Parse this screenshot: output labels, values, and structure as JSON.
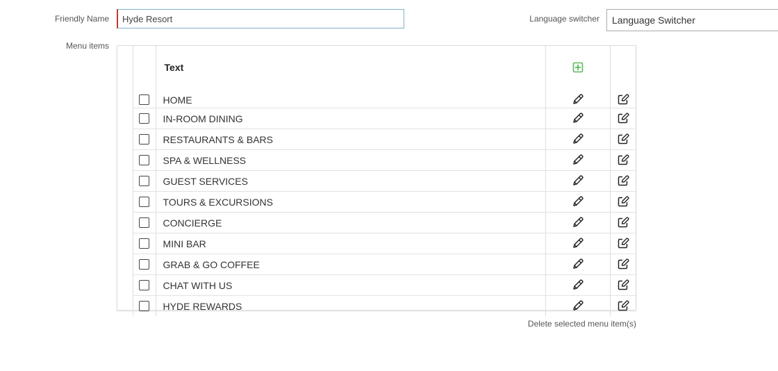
{
  "form": {
    "friendly_name_label": "Friendly Name",
    "friendly_name_value": "Hyde Resort",
    "language_switcher_label": "Language switcher",
    "language_switcher_value": "Language Switcher",
    "menu_items_label": "Menu items"
  },
  "menu_table": {
    "header_text": "Text",
    "add_icon": "plus-square-icon",
    "edit_icon": "pencil-icon",
    "edit_alt_icon": "edit-square-icon",
    "rows": [
      {
        "text": "HOME"
      },
      {
        "text": "IN-ROOM DINING"
      },
      {
        "text": "RESTAURANTS & BARS"
      },
      {
        "text": "SPA & WELLNESS"
      },
      {
        "text": "GUEST SERVICES"
      },
      {
        "text": "TOURS & EXCURSIONS"
      },
      {
        "text": "CONCIERGE"
      },
      {
        "text": "MINI BAR"
      },
      {
        "text": "GRAB & GO COFFEE"
      },
      {
        "text": "CHAT WITH US"
      },
      {
        "text": "HYDE REWARDS"
      }
    ]
  },
  "actions": {
    "delete_selected_label": "Delete selected menu item(s)"
  },
  "colors": {
    "add_icon": "#5cb85c",
    "required_marker": "#c0392b",
    "input_border_focus": "#7fb3c8"
  }
}
